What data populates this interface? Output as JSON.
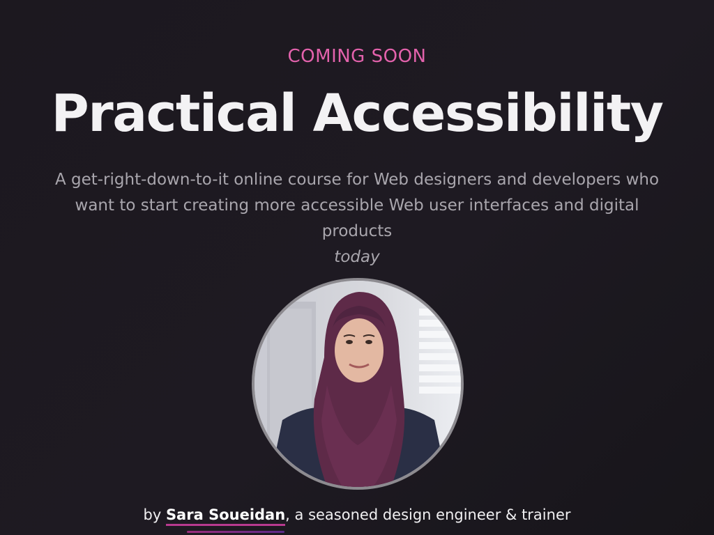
{
  "hero": {
    "eyebrow": "COMING SOON",
    "title": "Practical Accessibility",
    "subtitle_main": "A get-right-down-to-it online course for Web designers and developers who want to start creating more accessible Web user interfaces and digital products",
    "subtitle_emphasis": "today"
  },
  "byline": {
    "prefix": "by ",
    "author": "Sara Soueidan",
    "suffix": ", a seasoned design engineer & trainer"
  },
  "colors": {
    "accent": "#e362ac",
    "background": "#1c181f",
    "link_underline": "#b83a8f",
    "subtitle": "#a9a6ad"
  }
}
